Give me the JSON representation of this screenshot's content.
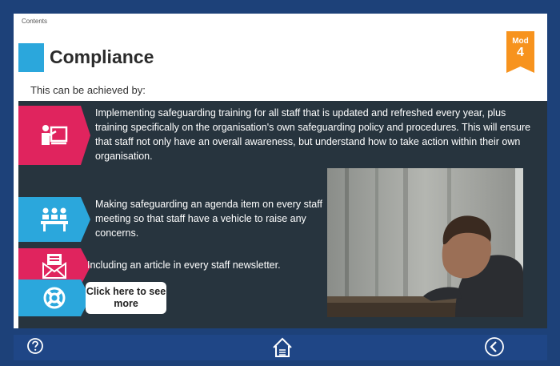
{
  "breadcrumb": "Contents",
  "page_title": "Compliance",
  "module_badge": {
    "label": "Mod",
    "number": "4"
  },
  "intro": "This can be achieved by:",
  "bullets": [
    {
      "icon": "presentation-icon",
      "text": "Implementing safeguarding training for all staff that is updated and refreshed every year, plus training specifically on the organisation's own safeguarding policy and procedures. This will ensure that staff not only have an overall awareness, but understand how to take action within their own organisation."
    },
    {
      "icon": "meeting-icon",
      "text": "Making safeguarding an agenda item on every staff meeting so that staff have a vehicle to raise any concerns."
    },
    {
      "icon": "newsletter-icon",
      "text": "Including an article in every staff newsletter."
    }
  ],
  "cta": {
    "icon": "lifebuoy-icon",
    "label": "Click here to see more"
  },
  "footer": {
    "help": "help-icon",
    "home": "home-icon",
    "back": "back-arrow-icon"
  },
  "colors": {
    "navy": "#1d4179",
    "footer": "#1f4686",
    "panel": "#27343e",
    "pink": "#e0245e",
    "blue": "#2ba7dc",
    "orange": "#f7931e"
  }
}
